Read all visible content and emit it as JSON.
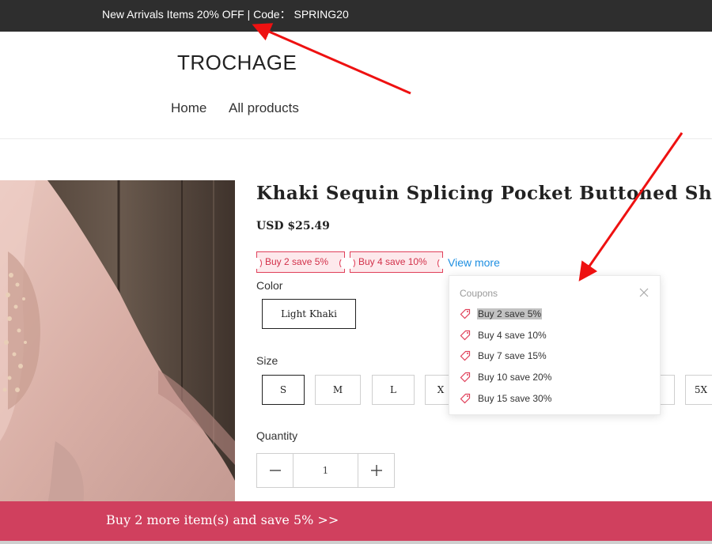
{
  "announcement": {
    "text": "New Arrivals Items 20% OFF | Code： SPRING20"
  },
  "header": {
    "logo": "TROCHAGE",
    "nav": [
      {
        "label": "Home"
      },
      {
        "label": "All products"
      }
    ]
  },
  "product": {
    "title": "Khaki Sequin Splicing Pocket Buttoned Shirt",
    "price": "USD $25.49",
    "coupon_tags": [
      "Buy 2 save 5%",
      "Buy 4 save 10%"
    ],
    "view_more": "View more",
    "color_label": "Color",
    "color_options": [
      "Light Khaki"
    ],
    "selected_color": "Light Khaki",
    "size_label": "Size",
    "size_options": [
      "S",
      "M",
      "L",
      "X",
      "",
      "5X"
    ],
    "selected_size": "S",
    "quantity_label": "Quantity",
    "quantity": "1"
  },
  "coupons_popover": {
    "title": "Coupons",
    "items": [
      "Buy 2 save 5%",
      "Buy 4 save 10%",
      "Buy 7 save 15%",
      "Buy 10 save 20%",
      "Buy 15 save 30%"
    ],
    "highlighted_index": 0
  },
  "bottom_bar": {
    "text": "Buy 2 more item(s) and save 5%  >>"
  },
  "colors": {
    "announcement_bg": "#2e2e2e",
    "accent_red": "#d0405e",
    "coupon_tag_border": "#e0405a",
    "coupon_tag_bg": "#fde9ec",
    "link_blue": "#1e8fe1",
    "annotation_arrow": "#ee1111"
  }
}
